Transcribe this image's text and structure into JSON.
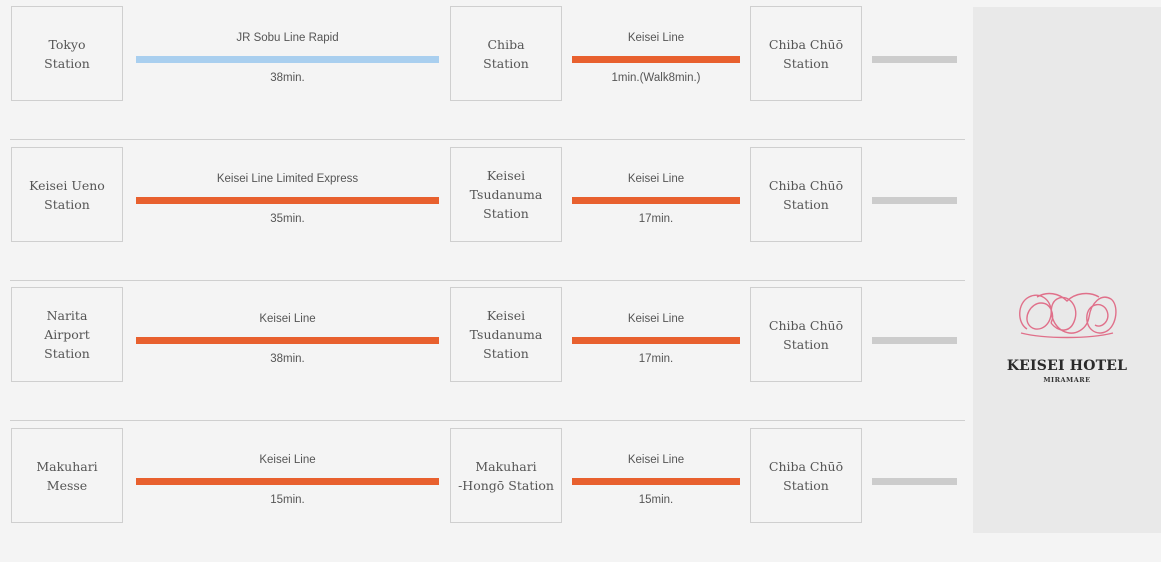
{
  "colors": {
    "rapid_line": "#a9cfef",
    "keisei_line": "#e8602e",
    "tail": "#cccccc",
    "logo": "#e0708a"
  },
  "routes": [
    {
      "from": "Tokyo\nStation",
      "seg1": {
        "name": "JR Sobu Line Rapid",
        "time": "38min.",
        "color": "#a9cfef"
      },
      "mid": "Chiba\nStation",
      "seg2": {
        "name": "Keisei Line",
        "time": "1min.(Walk8min.)",
        "color": "#e8602e"
      },
      "to": "Chiba Chūō\nStation"
    },
    {
      "from": "Keisei Ueno\nStation",
      "seg1": {
        "name": "Keisei Line Limited Express",
        "time": "35min.",
        "color": "#e8602e"
      },
      "mid": "Keisei\nTsudanuma\nStation",
      "seg2": {
        "name": "Keisei Line",
        "time": "17min.",
        "color": "#e8602e"
      },
      "to": "Chiba Chūō\nStation"
    },
    {
      "from": "Narita\nAirport\nStation",
      "seg1": {
        "name": "Keisei Line",
        "time": "38min.",
        "color": "#e8602e"
      },
      "mid": "Keisei\nTsudanuma\nStation",
      "seg2": {
        "name": "Keisei Line",
        "time": "17min.",
        "color": "#e8602e"
      },
      "to": "Chiba Chūō\nStation"
    },
    {
      "from": "Makuhari\nMesse",
      "seg1": {
        "name": "Keisei Line",
        "time": "15min.",
        "color": "#e8602e"
      },
      "mid": "Makuhari\n-Hongō Station",
      "seg2": {
        "name": "Keisei Line",
        "time": "15min.",
        "color": "#e8602e"
      },
      "to": "Chiba Chūō\nStation"
    }
  ],
  "hotel": {
    "name": "KEISEI HOTEL",
    "subtitle": "MIRAMARE",
    "logo_icon": "keisei-hotel-miramare-logo"
  }
}
